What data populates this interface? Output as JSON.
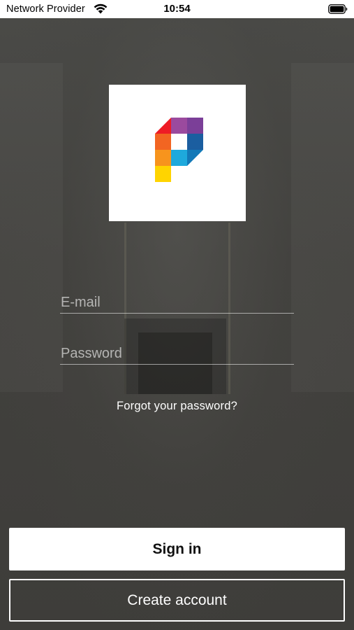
{
  "status_bar": {
    "carrier": "Network Provider",
    "time": "10:54",
    "wifi_icon": "wifi-icon",
    "battery_icon": "battery-icon"
  },
  "logo": {
    "icon": "p-logo-icon",
    "colors": [
      "#ee1c25",
      "#9b4a9e",
      "#7b3f98",
      "#f26522",
      "#1b5ea0",
      "#f7941d",
      "#1ea9dc",
      "#ffd400"
    ]
  },
  "form": {
    "email_placeholder": "E-mail",
    "email_value": "",
    "password_placeholder": "Password",
    "password_value": "",
    "forgot_label": "Forgot your password?"
  },
  "actions": {
    "signin_label": "Sign in",
    "create_label": "Create account"
  }
}
